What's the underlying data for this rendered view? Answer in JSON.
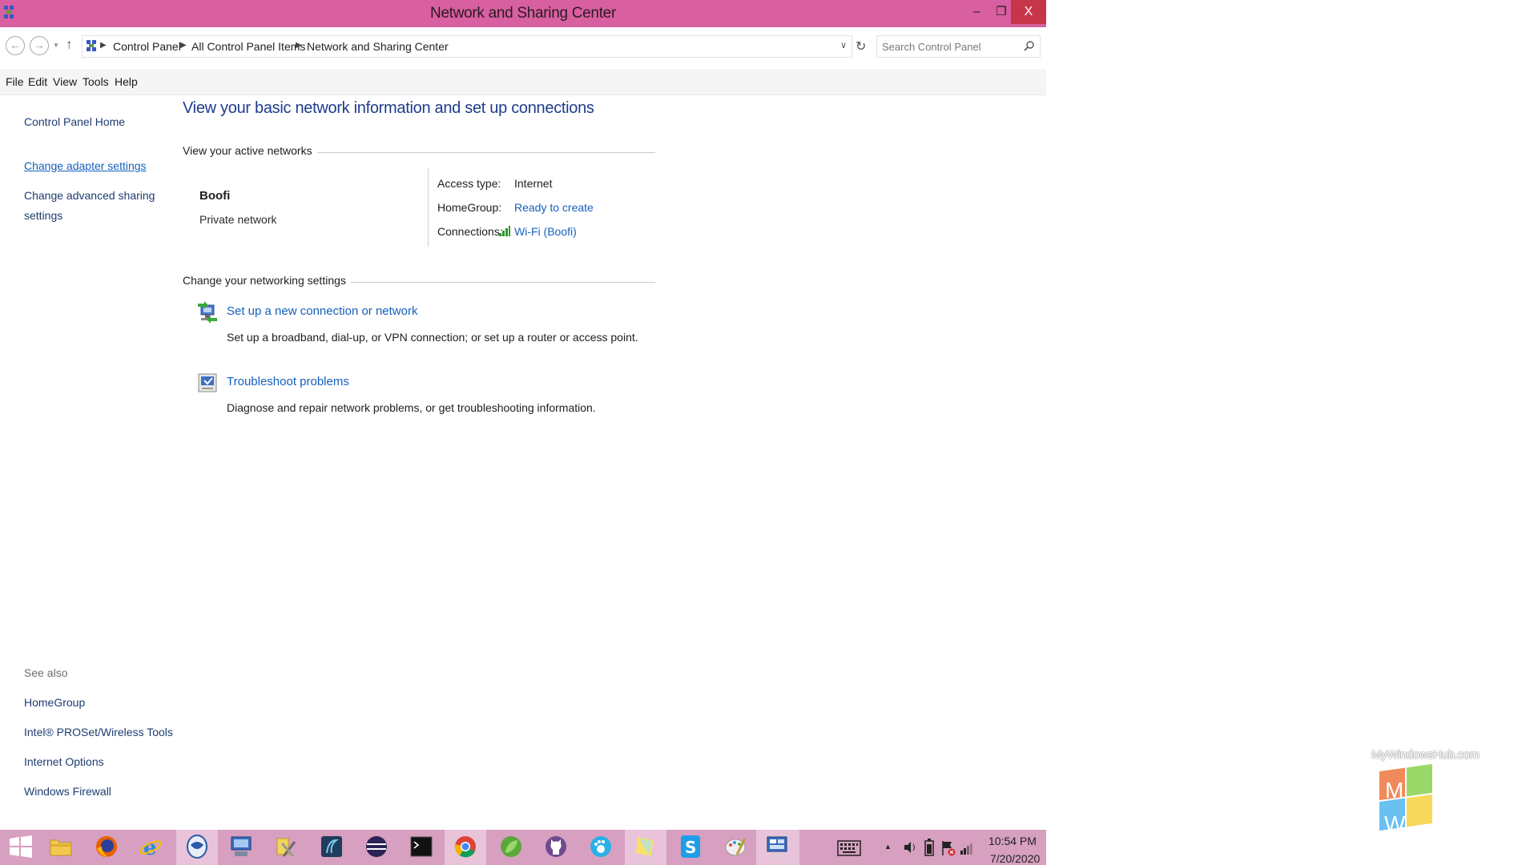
{
  "window": {
    "title": "Network and Sharing Center",
    "controls": {
      "minimize": "–",
      "maximize": "❐",
      "close": "X"
    }
  },
  "address_bar": {
    "crumbs": [
      "Control Panel",
      "All Control Panel Items",
      "Network and Sharing Center"
    ],
    "search_placeholder": "Search Control Panel"
  },
  "menu": [
    "File",
    "Edit",
    "View",
    "Tools",
    "Help"
  ],
  "left_pane": {
    "home": "Control Panel Home",
    "links": [
      "Change adapter settings",
      "Change advanced sharing",
      "settings"
    ],
    "see_also_title": "See also",
    "see_also": [
      "HomeGroup",
      "Intel® PROSet/Wireless Tools",
      "Internet Options",
      "Windows Firewall"
    ]
  },
  "main": {
    "heading": "View your basic network information and set up connections",
    "active_networks_title": "View your active networks",
    "network": {
      "name": "Boofi",
      "type": "Private network",
      "access_type_label": "Access type:",
      "access_type_value": "Internet",
      "homegroup_label": "HomeGroup:",
      "homegroup_value": "Ready to create",
      "connections_label": "Connections:",
      "connections_value": "Wi-Fi (Boofi)"
    },
    "change_settings_title": "Change your networking settings",
    "tasks": [
      {
        "link": "Set up a new connection or network",
        "desc": "Set up a broadband, dial-up, or VPN connection; or set up a router or access point.",
        "icon": "network-setup-icon"
      },
      {
        "link": "Troubleshoot problems",
        "desc": "Diagnose and repair network problems, or get troubleshooting information.",
        "icon": "troubleshoot-icon"
      }
    ]
  },
  "taskbar": {
    "apps": [
      "start",
      "file-explorer",
      "firefox",
      "internet-explorer",
      "chat",
      "remote-desktop",
      "tools",
      "code-editor",
      "eclipse",
      "terminal",
      "chrome",
      "leaf-app",
      "github",
      "paw-app",
      "sticky-notes",
      "skype",
      "paint",
      "control-panel"
    ],
    "clock_time": "10:54 PM",
    "clock_date": "7/20/2020"
  },
  "watermark": {
    "text": "MyWindowsHub.com",
    "letters": [
      "M",
      "W"
    ]
  },
  "colors": {
    "titlebar": "#d85fa0",
    "close": "#c7354a",
    "taskbar": "#d79fc0",
    "link": "#1560bd",
    "heading": "#1e3c8c"
  }
}
